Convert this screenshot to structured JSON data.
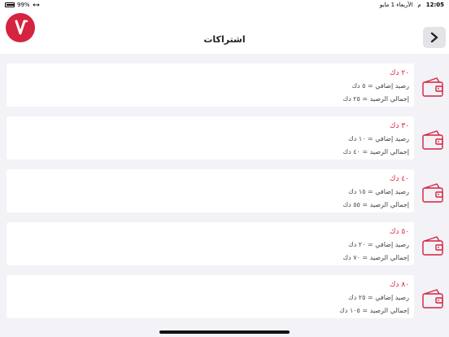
{
  "status_bar": {
    "battery": "99%",
    "time": "12:05",
    "meridiem": "م",
    "date": "الأربعاء 1 مايو"
  },
  "header": {
    "title": "اشتراكات"
  },
  "plans": [
    {
      "title": "٢٠ دك",
      "extra": "رصيد إضافي = ٥ دك",
      "total": "إجمالي الرصيد = ٢٥ دك"
    },
    {
      "title": "٣٠ دك",
      "extra": "رصيد إضافي = ١٠ دك",
      "total": "إجمالي الرصيد = ٤٠ دك"
    },
    {
      "title": "٤٠ دك",
      "extra": "رصيد إضافي = ١٥ دك",
      "total": "إجمالي الرصيد = ٥٥ دك"
    },
    {
      "title": "٥٠ دك",
      "extra": "رصيد إضافي = ٢٠ دك",
      "total": "إجمالي الرصيد = ٧٠ دك"
    },
    {
      "title": "٨٠ دك",
      "extra": "رصيد إضافي = ٢٥ دك",
      "total": "إجمالي الرصيد = ١٠٥ دك"
    }
  ],
  "colors": {
    "accent": "#d6233f",
    "background": "#f2f2f7"
  },
  "icons": {
    "logo": "brand-logo",
    "back": "chevron-right-icon",
    "plan": "wallet-icon"
  }
}
